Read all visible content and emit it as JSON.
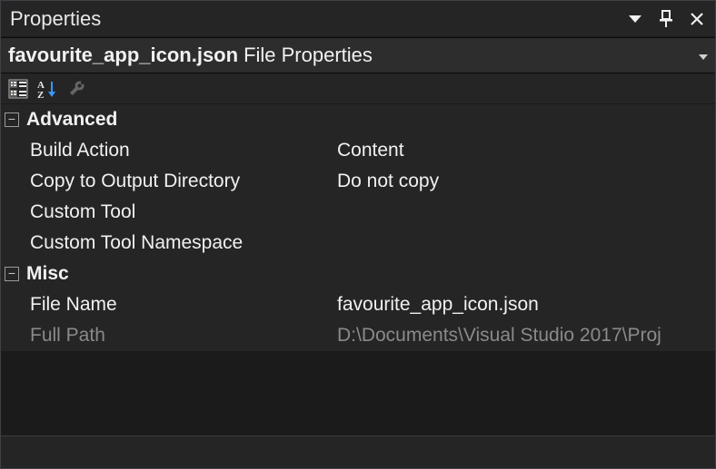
{
  "titlebar": {
    "title": "Properties"
  },
  "object": {
    "name": "favourite_app_icon.json",
    "type_label": "File Properties"
  },
  "groups": [
    {
      "title": "Advanced",
      "rows": [
        {
          "label": "Build Action",
          "value": "Content",
          "disabled": false
        },
        {
          "label": "Copy to Output Directory",
          "value": "Do not copy",
          "disabled": false
        },
        {
          "label": "Custom Tool",
          "value": "",
          "disabled": false
        },
        {
          "label": "Custom Tool Namespace",
          "value": "",
          "disabled": false
        }
      ]
    },
    {
      "title": "Misc",
      "rows": [
        {
          "label": "File Name",
          "value": "favourite_app_icon.json",
          "disabled": false
        },
        {
          "label": "Full Path",
          "value": "D:\\Documents\\Visual Studio 2017\\Proj",
          "disabled": true
        }
      ]
    }
  ]
}
